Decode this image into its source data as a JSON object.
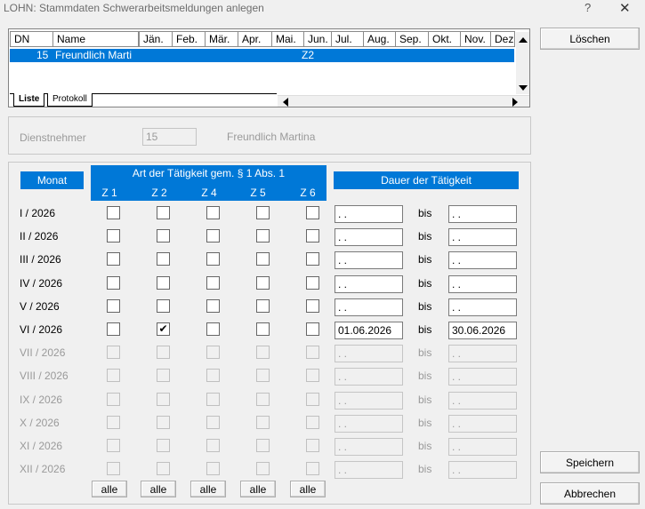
{
  "window": {
    "title": "LOHN: Stammdaten Schwerarbeitsmeldungen anlegen",
    "help_glyph": "?",
    "close_glyph": "✕"
  },
  "grid": {
    "columns": [
      "DN",
      "Name",
      "Jän.",
      "Feb.",
      "Mär.",
      "Apr.",
      "Mai.",
      "Jun.",
      "Jul.",
      "Aug.",
      "Sep.",
      "Okt.",
      "Nov.",
      "Dez"
    ],
    "selected_row": {
      "dn": "15",
      "name": "Freundlich Marti",
      "jun": "Z2"
    },
    "tabs": [
      "Liste",
      "Protokoll"
    ]
  },
  "dienstnehmer": {
    "label": "Dienstnehmer",
    "number": "15",
    "name": "Freundlich Martina"
  },
  "headers": {
    "monat": "Monat",
    "art": "Art der Tätigkeit gem. § 1 Abs. 1",
    "z": [
      "Z 1",
      "Z 2",
      "Z 4",
      "Z 5",
      "Z 6"
    ],
    "dauer": "Dauer der Tätigkeit"
  },
  "months": [
    {
      "label": "I / 2026",
      "enabled": true,
      "checks": [
        false,
        false,
        false,
        false,
        false
      ],
      "from": ". .",
      "to": ". ."
    },
    {
      "label": "II / 2026",
      "enabled": true,
      "checks": [
        false,
        false,
        false,
        false,
        false
      ],
      "from": ". .",
      "to": ". ."
    },
    {
      "label": "III / 2026",
      "enabled": true,
      "checks": [
        false,
        false,
        false,
        false,
        false
      ],
      "from": ". .",
      "to": ". ."
    },
    {
      "label": "IV / 2026",
      "enabled": true,
      "checks": [
        false,
        false,
        false,
        false,
        false
      ],
      "from": ". .",
      "to": ". ."
    },
    {
      "label": "V / 2026",
      "enabled": true,
      "checks": [
        false,
        false,
        false,
        false,
        false
      ],
      "from": ". .",
      "to": ". ."
    },
    {
      "label": "VI / 2026",
      "enabled": true,
      "checks": [
        false,
        true,
        false,
        false,
        false
      ],
      "from": "01.06.2026",
      "to": "30.06.2026"
    },
    {
      "label": "VII / 2026",
      "enabled": false,
      "checks": [
        false,
        false,
        false,
        false,
        false
      ],
      "from": ". .",
      "to": ". ."
    },
    {
      "label": "VIII / 2026",
      "enabled": false,
      "checks": [
        false,
        false,
        false,
        false,
        false
      ],
      "from": ". .",
      "to": ". ."
    },
    {
      "label": "IX / 2026",
      "enabled": false,
      "checks": [
        false,
        false,
        false,
        false,
        false
      ],
      "from": ". .",
      "to": ". ."
    },
    {
      "label": "X / 2026",
      "enabled": false,
      "checks": [
        false,
        false,
        false,
        false,
        false
      ],
      "from": ". .",
      "to": ". ."
    },
    {
      "label": "XI / 2026",
      "enabled": false,
      "checks": [
        false,
        false,
        false,
        false,
        false
      ],
      "from": ". .",
      "to": ". ."
    },
    {
      "label": "XII / 2026",
      "enabled": false,
      "checks": [
        false,
        false,
        false,
        false,
        false
      ],
      "from": ". .",
      "to": ". ."
    }
  ],
  "bis_label": "bis",
  "alle_label": "alle",
  "check_glyph": "✔",
  "buttons": {
    "loeschen": "Löschen",
    "speichern": "Speichern",
    "abbrechen": "Abbrechen"
  },
  "colors": {
    "accent": "#0078d7",
    "background": "#f0f0f0"
  }
}
